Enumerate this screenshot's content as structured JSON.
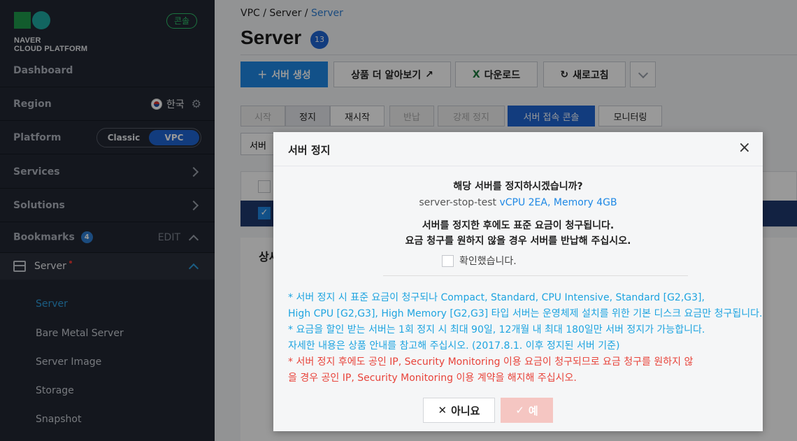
{
  "brand": {
    "line1": "NAVER",
    "line2": "CLOUD PLATFORM",
    "console_badge": "콘솔"
  },
  "sidebar": {
    "dashboard": "Dashboard",
    "region_label": "Region",
    "region_value": "한국",
    "platform_label": "Platform",
    "platform_options": [
      "Classic",
      "VPC"
    ],
    "services": "Services",
    "solutions": "Solutions",
    "bookmarks": "Bookmarks",
    "bookmarks_count": "4",
    "edit": "EDIT",
    "server_section": "Server",
    "sub_items": [
      "Server",
      "Bare Metal Server",
      "Server Image",
      "Storage",
      "Snapshot"
    ]
  },
  "breadcrumb": {
    "a": "VPC",
    "b": "Server",
    "c": "Server",
    "sep": "/"
  },
  "page": {
    "title": "Server",
    "count": "13"
  },
  "toolbar": {
    "create": "서버 생성",
    "learn_more": "상품 더 알아보기",
    "download": "다운로드",
    "refresh": "새로고침"
  },
  "actions": [
    "시작",
    "정지",
    "재시작",
    "반납",
    "강제 정지",
    "서버 접속 콘솔",
    "모니터링"
  ],
  "filter_label": "서버",
  "detail_title": "상세",
  "modal": {
    "title": "서버 정지",
    "close": "×",
    "question": "해당 서버를 정지하시겠습니까?",
    "server_name": "server-stop-test",
    "server_spec": "vCPU 2EA, Memory 4GB",
    "warn1": "서버를 정지한 후에도 표준 요금이 청구됩니다.",
    "warn2": "요금 청구를 원하지 않을 경우 서버를 반납해 주십시오.",
    "confirm_label": "확인했습니다.",
    "notes_blue": [
      "* 서버 정지 시 표준 요금이 청구되나 Compact, Standard, CPU Intensive, Standard [G2,G3],",
      "High CPU [G2,G3], High Memory [G2,G3] 타입 서버는 운영체제 설치를 위한 기본 디스크 요금만 청구됩니다.",
      "* 요금을 할인 받는 서버는 1회 정지 시 최대 90일, 12개월 내 최대 180일만 서버 정지가 가능합니다.",
      "자세한 내용은 상품 안내를 참고해 주십시오. (2017.8.1. 이후 정지된 서버 기준)"
    ],
    "notes_red": [
      "* 서버 정지 후에도 공인 IP, Security Monitoring 이용 요금이 청구되므로 요금 청구를 원하지 않",
      "을 경우 공인 IP, Security Monitoring 이용 계약을 해지해 주십시오."
    ],
    "btn_no": "아니요",
    "btn_yes": "예"
  }
}
